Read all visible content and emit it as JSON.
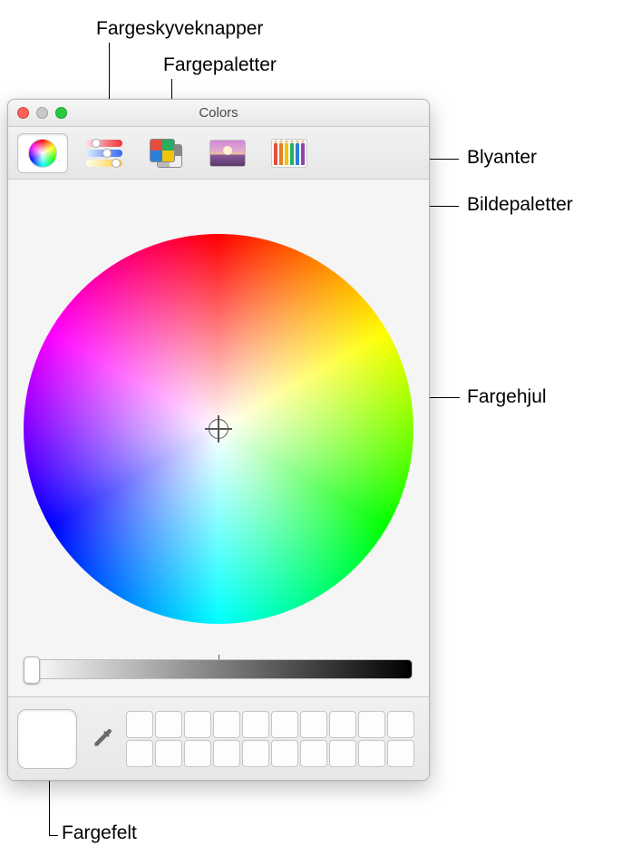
{
  "window": {
    "title": "Colors"
  },
  "callouts": {
    "sliders": "Fargeskyveknapper",
    "palettes": "Fargepaletter",
    "pencils": "Blyanter",
    "image_palettes": "Bildepaletter",
    "color_wheel": "Fargehjul",
    "color_well": "Fargefelt"
  },
  "toolbar": {
    "items": [
      {
        "id": "wheel",
        "name": "color-wheel-tab",
        "selected": true
      },
      {
        "id": "sliders",
        "name": "color-sliders-tab",
        "selected": false
      },
      {
        "id": "palettes",
        "name": "color-palettes-tab",
        "selected": false
      },
      {
        "id": "image",
        "name": "image-palettes-tab",
        "selected": false
      },
      {
        "id": "pencils",
        "name": "pencils-tab",
        "selected": false
      }
    ]
  },
  "brightness": {
    "value": 1.0,
    "min": 0.0,
    "max": 1.0
  },
  "swatches": {
    "rows": 2,
    "cols": 10
  }
}
